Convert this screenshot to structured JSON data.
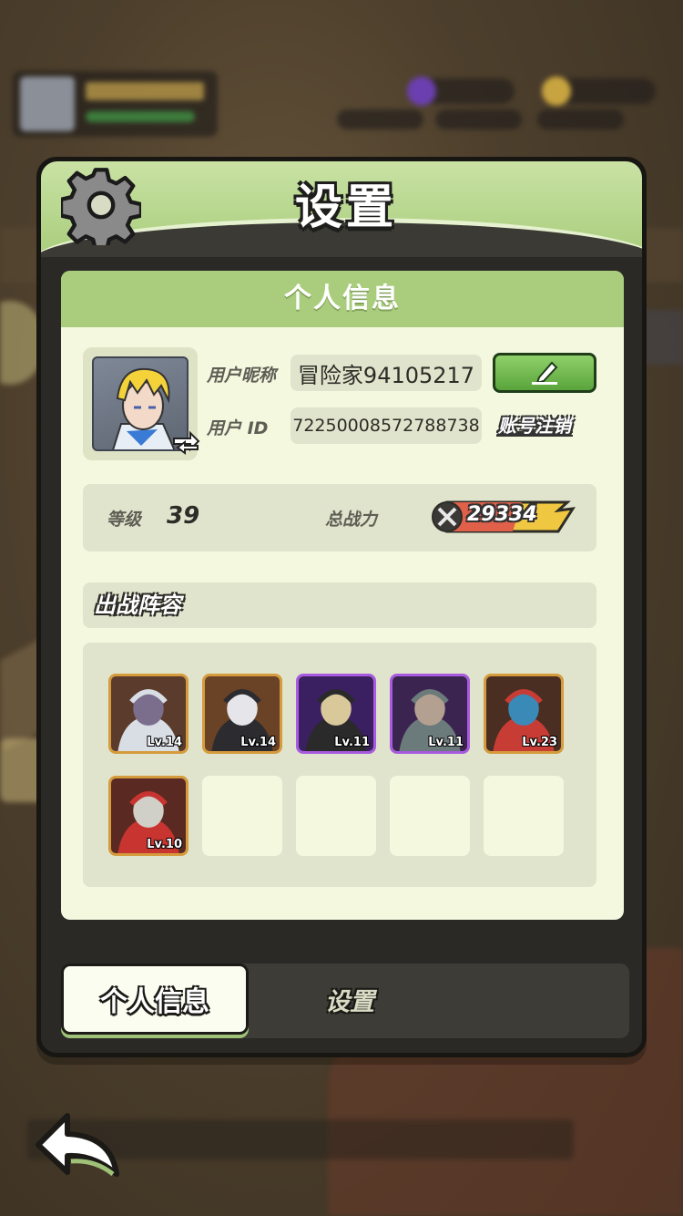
{
  "header": {
    "title": "设置"
  },
  "section": {
    "title": "个人信息"
  },
  "profile": {
    "nickname_label": "用户昵称",
    "nickname_value": "冒险家94105217",
    "id_label": "用户 ID",
    "id_value": "72250008572788738",
    "cancel_account_label": "账号注销"
  },
  "stats": {
    "level_label": "等级",
    "level_value": "39",
    "power_label": "总战力",
    "power_value": "29334"
  },
  "lineup": {
    "title": "出战阵容",
    "heroes": [
      {
        "level": "Lv.14",
        "frame": "gold",
        "art": "pale-ghost-hero"
      },
      {
        "level": "Lv.14",
        "frame": "gold",
        "art": "dark-mage-hero"
      },
      {
        "level": "Lv.11",
        "frame": "purple",
        "art": "goat-demon-hero"
      },
      {
        "level": "Lv.11",
        "frame": "purple",
        "art": "minotaur-hero"
      },
      {
        "level": "Lv.23",
        "frame": "gold",
        "art": "red-hair-hero"
      },
      {
        "level": "Lv.10",
        "frame": "gold",
        "art": "red-hood-hero"
      },
      {
        "level": "",
        "frame": "empty"
      },
      {
        "level": "",
        "frame": "empty"
      },
      {
        "level": "",
        "frame": "empty"
      },
      {
        "level": "",
        "frame": "empty"
      }
    ]
  },
  "tabs": {
    "active_label": "个人信息",
    "inactive_label": "设置"
  },
  "colors": {
    "accent_green": "#a9cd7c",
    "panel_dark": "#2a2926",
    "content_bg": "#f4f8df",
    "gold_frame": "#d69b3c",
    "purple_frame": "#a85ae0"
  }
}
